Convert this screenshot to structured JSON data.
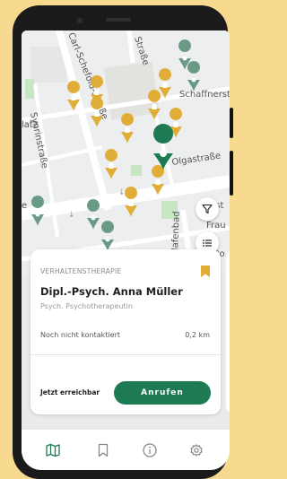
{
  "map": {
    "streets": [
      "Carl-Schefold-Straße",
      "Synrinstraße",
      "Schaffnerstraße",
      "Olgastraße",
      "Hafenbad",
      "Frau",
      "Ro",
      "latz",
      "Straße",
      "e",
      "nst"
    ],
    "user_pin_color": "#1d7a52",
    "result_pin_color": "#e0ad36",
    "other_pin_color": "#6a9a86"
  },
  "card": {
    "category": "VERHALTENSTHERAPIE",
    "name": "Dipl.-Psych. Anna Müller",
    "profession": "Psych. Psychotherapeutin",
    "status": "Noch nicht kontaktiert",
    "distance": "0,2 km",
    "reachability": "Jetzt erreichbar",
    "call_label": "Anrufen"
  },
  "nav": {
    "items": [
      "map-icon",
      "bookmark-icon",
      "info-icon",
      "settings-icon"
    ]
  }
}
